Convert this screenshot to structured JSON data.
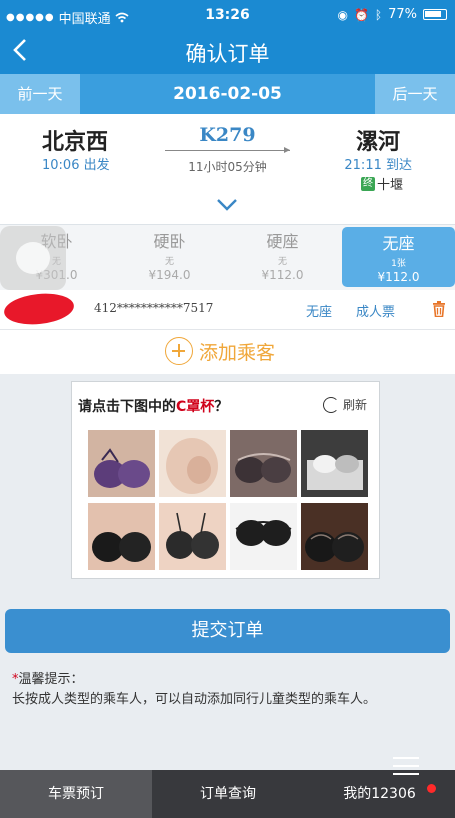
{
  "status_bar": {
    "carrier": "中国联通",
    "time": "13:26",
    "battery": "77%"
  },
  "nav": {
    "back": "<",
    "title": "确认订单"
  },
  "date_bar": {
    "prev": "前一天",
    "date": "2016-02-05",
    "next": "后一天"
  },
  "train": {
    "from_station": "北京西",
    "from_time": "10:06 出发",
    "train_no": "K279",
    "duration": "11小时05分钟",
    "to_station": "漯河",
    "to_time": "21:11 到达",
    "terminal_badge": "终",
    "terminal": "十堰"
  },
  "seats": [
    {
      "name": "软卧",
      "avail": "无",
      "price": "¥301.0"
    },
    {
      "name": "硬卧",
      "avail": "无",
      "price": "¥194.0"
    },
    {
      "name": "硬座",
      "avail": "无",
      "price": "¥112.0"
    },
    {
      "name": "无座",
      "avail": "1张",
      "price": "¥112.0"
    }
  ],
  "passenger": {
    "id_number": "412***********7517",
    "seat_type": "无座",
    "ticket_type": "成人票"
  },
  "add_passenger": "添加乘客",
  "captcha": {
    "question_prefix": "请点击下图中的",
    "question_highlight": "C罩杯",
    "question_suffix": "？",
    "refresh": "刷新"
  },
  "submit": "提交订单",
  "tip": {
    "star": "*",
    "title": "温馨提示：",
    "body": "长按成人类型的乘车人，可以自动添加同行儿童类型的乘车人。"
  },
  "tabs": [
    "车票预订",
    "订单查询",
    "我的12306"
  ]
}
